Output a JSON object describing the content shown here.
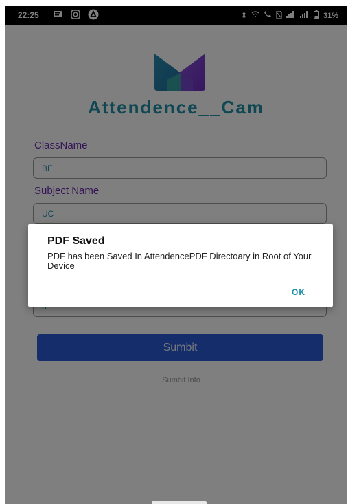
{
  "status_bar": {
    "time": "22:25",
    "battery": "31%",
    "left_icons": [
      "message-icon",
      "instagram-icon",
      "navigation-icon"
    ],
    "right_icons": [
      "data-arrows-icon",
      "wifi-icon",
      "call-icon",
      "no-sim-icon",
      "signal-icon",
      "signal-icon",
      "battery-icon"
    ]
  },
  "app": {
    "title": "Attendence__Cam",
    "colors": {
      "title": "#1e8fa6",
      "label": "#6a2bb0",
      "button": "#2d5ad8"
    }
  },
  "form": {
    "class_label": "ClassName",
    "class_value": "BE",
    "subject_label": "Subject Name",
    "subject_value": "UC",
    "hidden_field_value": "5",
    "submit_label": "Sumbit",
    "info_label": "Sumbit Info"
  },
  "dialog": {
    "title": "PDF Saved",
    "message": "PDF has been Saved In AttendencePDF Directoary in Root of Your Device",
    "ok_label": "OK"
  }
}
